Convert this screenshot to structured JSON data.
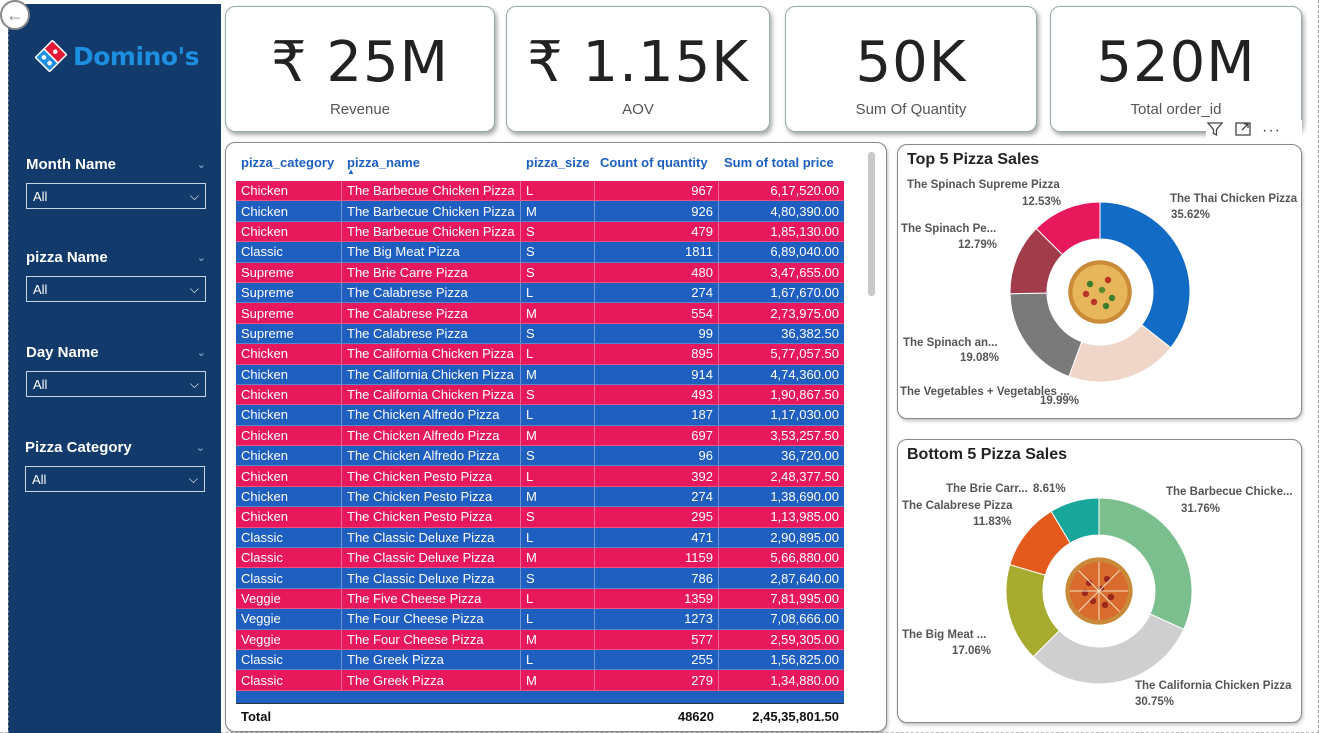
{
  "brand": {
    "name": "Domino's"
  },
  "slicers": [
    {
      "title": "Month Name",
      "value": "All"
    },
    {
      "title": "pizza Name",
      "value": "All"
    },
    {
      "title": "Day Name",
      "value": "All"
    },
    {
      "title": "Pizza Category",
      "value": "All"
    }
  ],
  "kpis": [
    {
      "value": "₹ 25M",
      "label": "Revenue"
    },
    {
      "value": "₹ 1.15K",
      "label": "AOV"
    },
    {
      "value": "50K",
      "label": "Sum Of Quantity"
    },
    {
      "value": "520M",
      "label": "Total order_id"
    }
  ],
  "table": {
    "columns": [
      "pizza_category",
      "pizza_name",
      "pizza_size",
      "Count of quantity",
      "Sum of total price"
    ],
    "rows": [
      [
        "Chicken",
        "The Barbecue Chicken Pizza",
        "L",
        "967",
        "6,17,520.00"
      ],
      [
        "Chicken",
        "The Barbecue Chicken Pizza",
        "M",
        "926",
        "4,80,390.00"
      ],
      [
        "Chicken",
        "The Barbecue Chicken Pizza",
        "S",
        "479",
        "1,85,130.00"
      ],
      [
        "Classic",
        "The Big Meat Pizza",
        "S",
        "1811",
        "6,89,040.00"
      ],
      [
        "Supreme",
        "The Brie Carre Pizza",
        "S",
        "480",
        "3,47,655.00"
      ],
      [
        "Supreme",
        "The Calabrese Pizza",
        "L",
        "274",
        "1,67,670.00"
      ],
      [
        "Supreme",
        "The Calabrese Pizza",
        "M",
        "554",
        "2,73,975.00"
      ],
      [
        "Supreme",
        "The Calabrese Pizza",
        "S",
        "99",
        "36,382.50"
      ],
      [
        "Chicken",
        "The California Chicken Pizza",
        "L",
        "895",
        "5,77,057.50"
      ],
      [
        "Chicken",
        "The California Chicken Pizza",
        "M",
        "914",
        "4,74,360.00"
      ],
      [
        "Chicken",
        "The California Chicken Pizza",
        "S",
        "493",
        "1,90,867.50"
      ],
      [
        "Chicken",
        "The Chicken Alfredo Pizza",
        "L",
        "187",
        "1,17,030.00"
      ],
      [
        "Chicken",
        "The Chicken Alfredo Pizza",
        "M",
        "697",
        "3,53,257.50"
      ],
      [
        "Chicken",
        "The Chicken Alfredo Pizza",
        "S",
        "96",
        "36,720.00"
      ],
      [
        "Chicken",
        "The Chicken Pesto Pizza",
        "L",
        "392",
        "2,48,377.50"
      ],
      [
        "Chicken",
        "The Chicken Pesto Pizza",
        "M",
        "274",
        "1,38,690.00"
      ],
      [
        "Chicken",
        "The Chicken Pesto Pizza",
        "S",
        "295",
        "1,13,985.00"
      ],
      [
        "Classic",
        "The Classic Deluxe Pizza",
        "L",
        "471",
        "2,90,895.00"
      ],
      [
        "Classic",
        "The Classic Deluxe Pizza",
        "M",
        "1159",
        "5,66,880.00"
      ],
      [
        "Classic",
        "The Classic Deluxe Pizza",
        "S",
        "786",
        "2,87,640.00"
      ],
      [
        "Veggie",
        "The Five Cheese Pizza",
        "L",
        "1359",
        "7,81,995.00"
      ],
      [
        "Veggie",
        "The Four Cheese Pizza",
        "L",
        "1273",
        "7,08,666.00"
      ],
      [
        "Veggie",
        "The Four Cheese Pizza",
        "M",
        "577",
        "2,59,305.00"
      ],
      [
        "Classic",
        "The Greek Pizza",
        "L",
        "255",
        "1,56,825.00"
      ],
      [
        "Classic",
        "The Greek Pizza",
        "M",
        "279",
        "1,34,880.00"
      ]
    ],
    "total": {
      "label": "Total",
      "quantity": "48620",
      "price": "2,45,35,801.50"
    }
  },
  "top5": {
    "title": "Top 5 Pizza Sales",
    "slices": [
      {
        "name": "The Thai Chicken Pizza",
        "pct": "35.62%",
        "value": 35.62,
        "color": "#126bc5"
      },
      {
        "name": "The Vegetables + Vegetables ...",
        "pct": "19.99%",
        "value": 19.99,
        "color": "#efd6c8"
      },
      {
        "name": "The Spinach an...",
        "pct": "19.08%",
        "value": 19.08,
        "color": "#7a7a7a"
      },
      {
        "name": "The Spinach Pe...",
        "pct": "12.79%",
        "value": 12.79,
        "color": "#a23c4b"
      },
      {
        "name": "The Spinach Supreme Pizza",
        "pct": "12.53%",
        "value": 12.53,
        "color": "#e8185c"
      }
    ]
  },
  "bottom5": {
    "title": "Bottom 5 Pizza Sales",
    "slices": [
      {
        "name": "The Barbecue Chicke...",
        "pct": "31.76%",
        "value": 31.76,
        "color": "#7bbf8f"
      },
      {
        "name": "The California Chicken Pizza",
        "pct": "30.75%",
        "value": 30.75,
        "color": "#cfcfcf"
      },
      {
        "name": "The Big Meat ...",
        "pct": "17.06%",
        "value": 17.06,
        "color": "#a7ab2f"
      },
      {
        "name": "The Calabrese Pizza",
        "pct": "11.83%",
        "value": 11.83,
        "color": "#e35a1c"
      },
      {
        "name": "The Brie Carr...",
        "pct": "8.61%",
        "value": 8.61,
        "color": "#18a79a"
      }
    ]
  },
  "icons": {
    "filter": "filter-icon",
    "focus": "focus-mode-icon",
    "more": "more-options-icon",
    "back": "back-arrow-icon"
  }
}
